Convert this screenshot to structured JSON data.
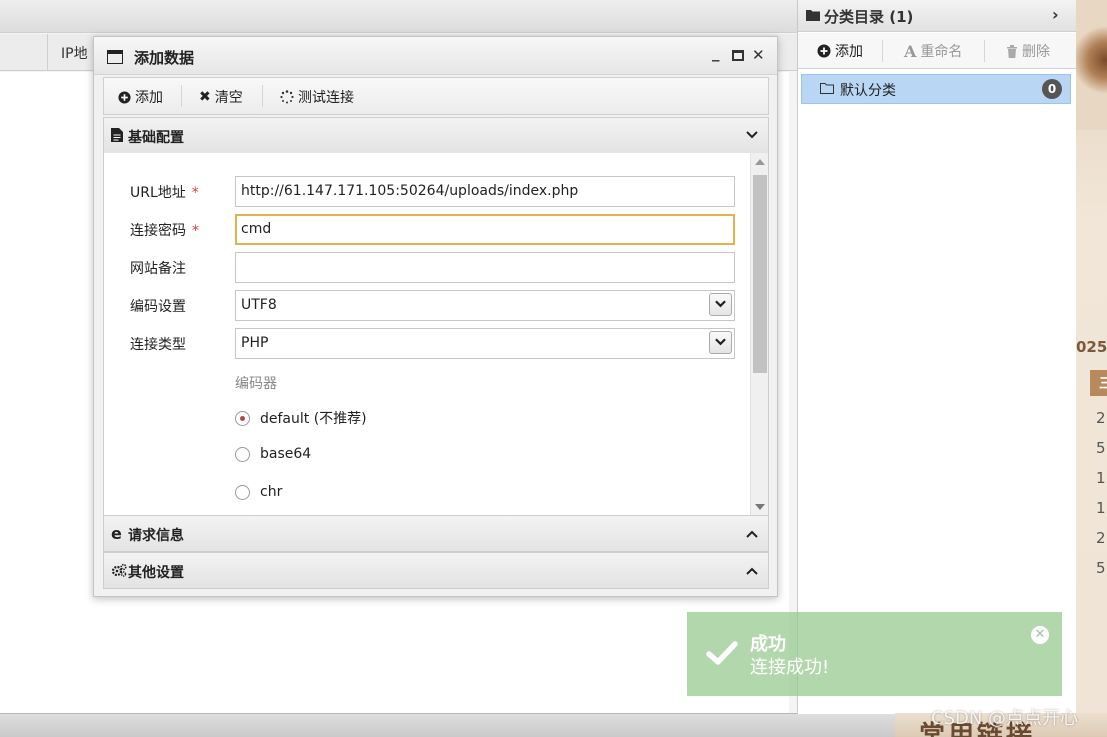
{
  "main": {
    "grid_header": {
      "ip_col": "IP地"
    }
  },
  "category": {
    "title": "分类目录 (1)",
    "tools": {
      "add": "添加",
      "rename": "重命名",
      "delete": "删除"
    },
    "items": [
      {
        "label": "默认分类",
        "count": "0"
      }
    ]
  },
  "dialog": {
    "title": "添加数据",
    "toolbar": {
      "add": "添加",
      "clear": "清空",
      "test": "测试连接"
    },
    "sections": {
      "basic": "基础配置",
      "request": "请求信息",
      "other": "其他设置"
    },
    "fields": {
      "url": {
        "label": "URL地址",
        "required": "*",
        "value": "http://61.147.171.105:50264/uploads/index.php"
      },
      "password": {
        "label": "连接密码",
        "required": "*",
        "value": "cmd"
      },
      "note": {
        "label": "网站备注",
        "value": ""
      },
      "encoding": {
        "label": "编码设置",
        "value": "UTF8"
      },
      "type": {
        "label": "连接类型",
        "value": "PHP"
      }
    },
    "encoder": {
      "label": "编码器",
      "options": [
        {
          "label": "default (不推荐)",
          "selected": true
        },
        {
          "label": "base64",
          "selected": false
        },
        {
          "label": "chr",
          "selected": false
        }
      ]
    }
  },
  "toast": {
    "title": "成功",
    "message": "连接成功!"
  },
  "decor": {
    "year": "025",
    "tab": "三",
    "nums": [
      "2",
      "5",
      "1",
      "1",
      "2",
      "5"
    ],
    "footer": "常用链接"
  },
  "watermark": "CSDN @点点开心"
}
